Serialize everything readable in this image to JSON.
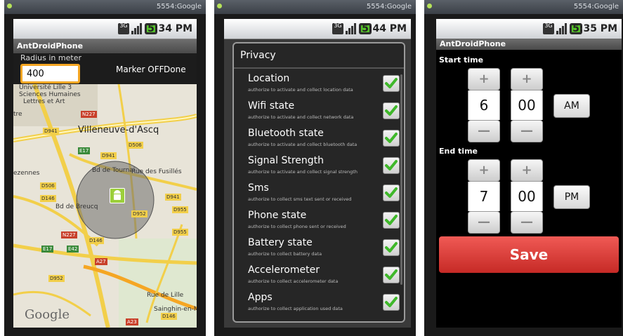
{
  "emulator": {
    "title_1": "5554:Google",
    "title_2": "5554:Google",
    "title_3": "5554:Google"
  },
  "screen1": {
    "status_time": "5:34 PM",
    "network_badge": "3G",
    "app_title": "AntDroidPhone",
    "radius_label": "Radius in meter",
    "radius_value": "400",
    "marker_button": "Marker OFF",
    "done_button": "Done",
    "map": {
      "labels": [
        "Villeneuve-d'Ascq",
        "Université Lille 3",
        "Sciences Humaines",
        "Lettres et Art",
        "Sainghin-en-Mél",
        "Bd de Tournai",
        "Rue des Fusillés",
        "Bd de Breucq",
        "Rue de Lille",
        "ezennes",
        "tre"
      ],
      "road_tags": [
        "N227",
        "D941",
        "D506",
        "D941",
        "E17",
        "D506",
        "D146",
        "D941",
        "D955",
        "D952",
        "N227",
        "E17",
        "E42",
        "D146",
        "A27",
        "D952",
        "A23",
        "D146",
        "D955"
      ],
      "attribution": "Google",
      "marker_icon": "android-icon"
    }
  },
  "screen2": {
    "status_time": "5:44 PM",
    "network_badge": "3G",
    "dialog_title": "Privacy",
    "items": [
      {
        "title": "Location",
        "summary": "authorize to activate and collect location data",
        "checked": true
      },
      {
        "title": "Wifi state",
        "summary": "authorize to activate and collect network data",
        "checked": true
      },
      {
        "title": "Bluetooth state",
        "summary": "authorize to activate and collect bluetooth data",
        "checked": true
      },
      {
        "title": "Signal Strength",
        "summary": "authorize to activate and collect signal strength",
        "checked": true
      },
      {
        "title": "Sms",
        "summary": "authorize to collect sms text sent or received",
        "checked": true
      },
      {
        "title": "Phone state",
        "summary": "authorize to collect phone sent or received",
        "checked": true
      },
      {
        "title": "Battery state",
        "summary": "authorize to collect battery data",
        "checked": true
      },
      {
        "title": "Accelerometer",
        "summary": "authorize to collect accelerometer data",
        "checked": true
      },
      {
        "title": "Apps",
        "summary": "authorize to collect application used data",
        "checked": true
      }
    ]
  },
  "screen3": {
    "status_time": "5:35 PM",
    "network_badge": "3G",
    "app_title": "AntDroidPhone",
    "start_label": "Start time",
    "start_hour": "6",
    "start_minute": "00",
    "start_ampm": "AM",
    "end_label": "End time",
    "end_hour": "7",
    "end_minute": "00",
    "end_ampm": "PM",
    "plus_symbol": "+",
    "minus_symbol": "—",
    "save_button": "Save"
  },
  "colors": {
    "accent_orange": "#f5a623",
    "check_green": "#3fb82a",
    "save_red": "#d93a35",
    "map_road_yellow": "#f2cf4a",
    "radius_circle": "#6e6e6e"
  }
}
